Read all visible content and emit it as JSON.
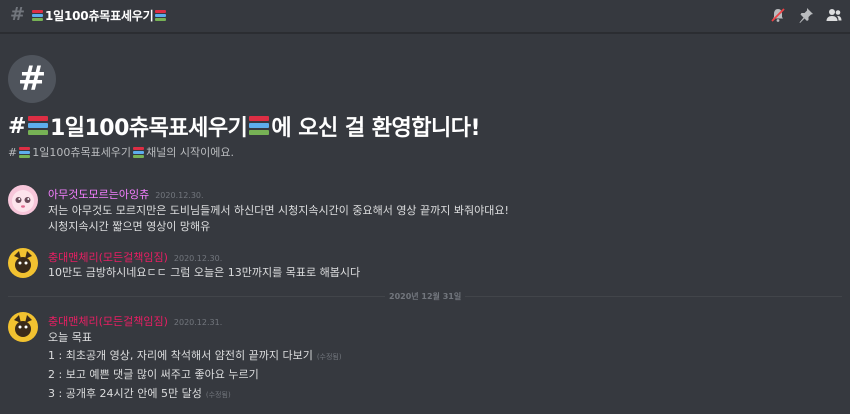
{
  "header": {
    "channel_name": "1일100츄목표세우기",
    "icons": [
      "bell-slash-icon",
      "pin-icon",
      "members-icon"
    ]
  },
  "welcome": {
    "title_prefix": "#",
    "channel_name": "1일100츄목표세우기",
    "title_suffix": "에 오신 걸 환영합니다!",
    "sub_prefix": "#",
    "sub_suffix": "채널의 시작이에요."
  },
  "messages": [
    {
      "author": "아무것도모르는아잉츄",
      "author_color": "#f47fff",
      "time": "2020.12.30.",
      "lines": [
        "저는 아무것도 모르지만은 도비님들께서 하신다면 시청지속시간이 중요해서 영상 끝까지 봐줘야대요!",
        "시청지속시간 짧으면 영상이 망해유"
      ]
    },
    {
      "author": "충대맨체리(모든걸책임짐)",
      "author_color": "#e91e63",
      "time": "2020.12.30.",
      "lines": [
        "10만도 금방하시네요ㄷㄷ 그럼 오늘은 13만까지를 목표로 해봅시다"
      ]
    }
  ],
  "date_divider": "2020년 12월 31일",
  "message3": {
    "author": "충대맨체리(모든걸책임짐)",
    "author_color": "#e91e63",
    "time": "2020.12.31.",
    "line0": "오늘 목표",
    "line1": "1 : 최초공개 영상, 자리에 착석해서 얌전히 끝까지 다보기",
    "line2": "2 : 보고 예쁜 댓글 많이 써주고 좋아요 누르기",
    "line3": "3 : 공개후 24시간 안에 5만 달성",
    "edited": "(수정됨)"
  },
  "colors": {
    "background": "#36393f",
    "muted": "#72767d",
    "text": "#dcddde"
  }
}
